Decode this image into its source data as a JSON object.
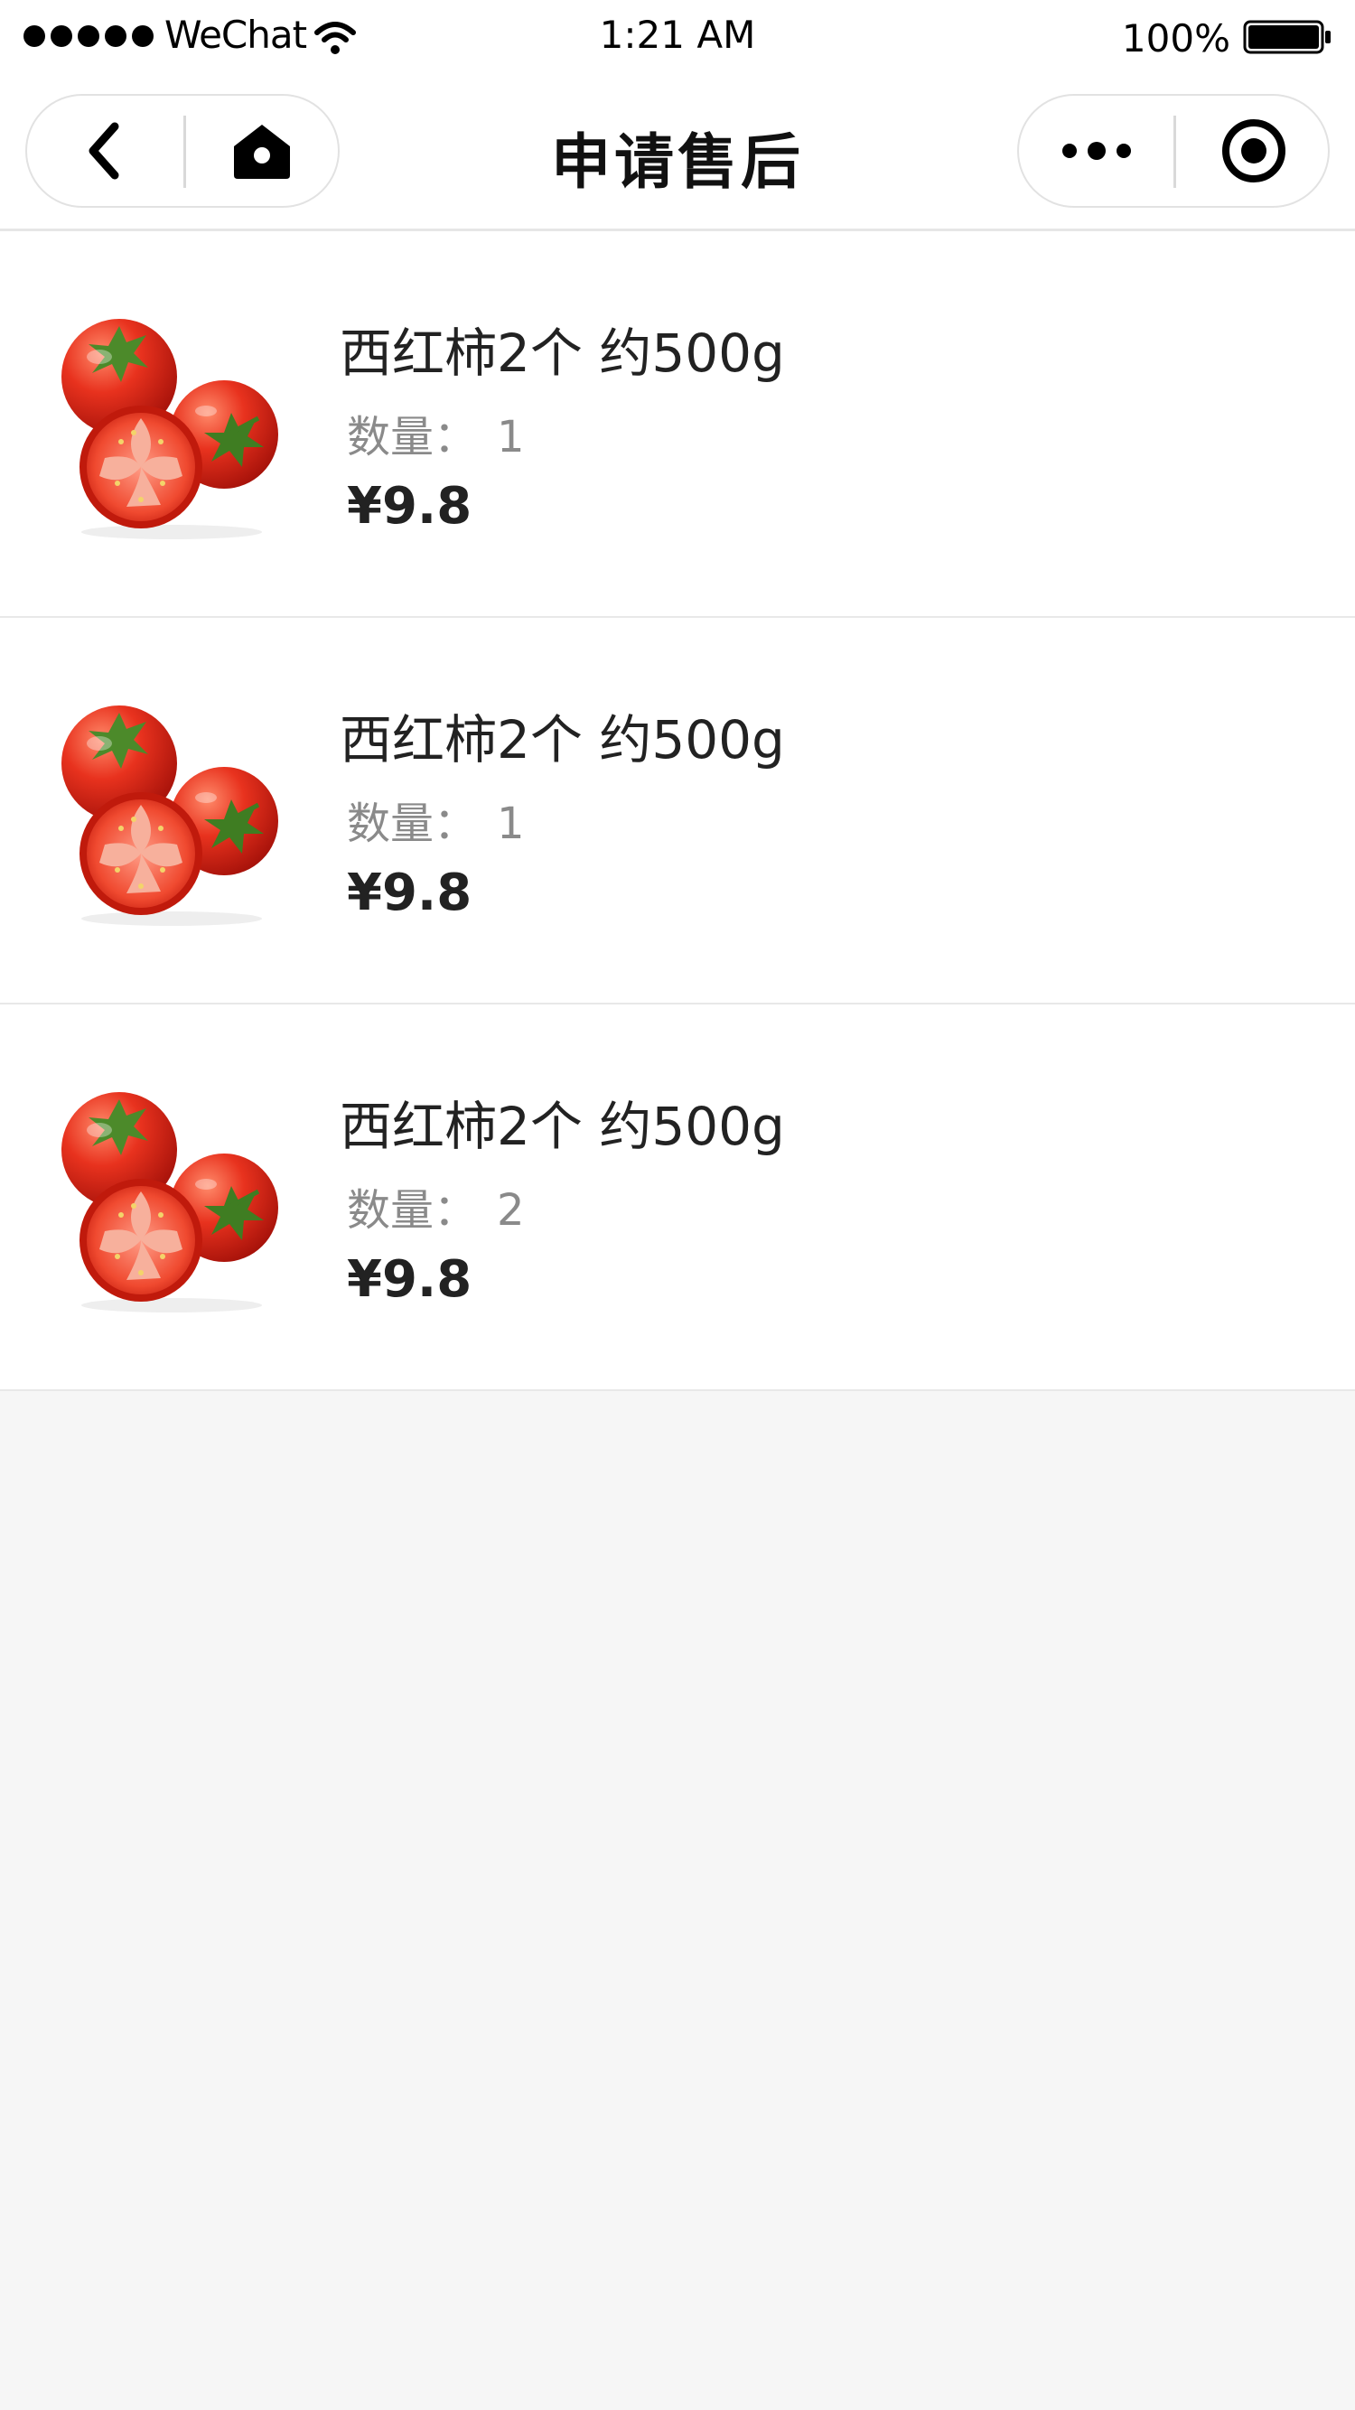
{
  "status_bar": {
    "carrier": "WeChat",
    "time": "1:21 AM",
    "battery": "100%",
    "icons": [
      "signal-dots-icon",
      "wifi-icon",
      "battery-icon"
    ]
  },
  "nav": {
    "title": "申请售后",
    "left_buttons": [
      "back-icon",
      "home-icon"
    ],
    "right_buttons": [
      "more-icon",
      "close-circle-icon"
    ]
  },
  "items": [
    {
      "name": "西红柿2个 约500g",
      "qty_label": "数量：",
      "qty": "1",
      "price": "¥9.8",
      "image": "tomato-image"
    },
    {
      "name": "西红柿2个 约500g",
      "qty_label": "数量：",
      "qty": "1",
      "price": "¥9.8",
      "image": "tomato-image"
    },
    {
      "name": "西红柿2个 约500g",
      "qty_label": "数量：",
      "qty": "2",
      "price": "¥9.8",
      "image": "tomato-image"
    }
  ],
  "colors": {
    "page_bg": "#f6f6f6",
    "card_bg": "#ffffff",
    "tomato": "#e02b1c",
    "muted_text": "#8a8a8a"
  }
}
